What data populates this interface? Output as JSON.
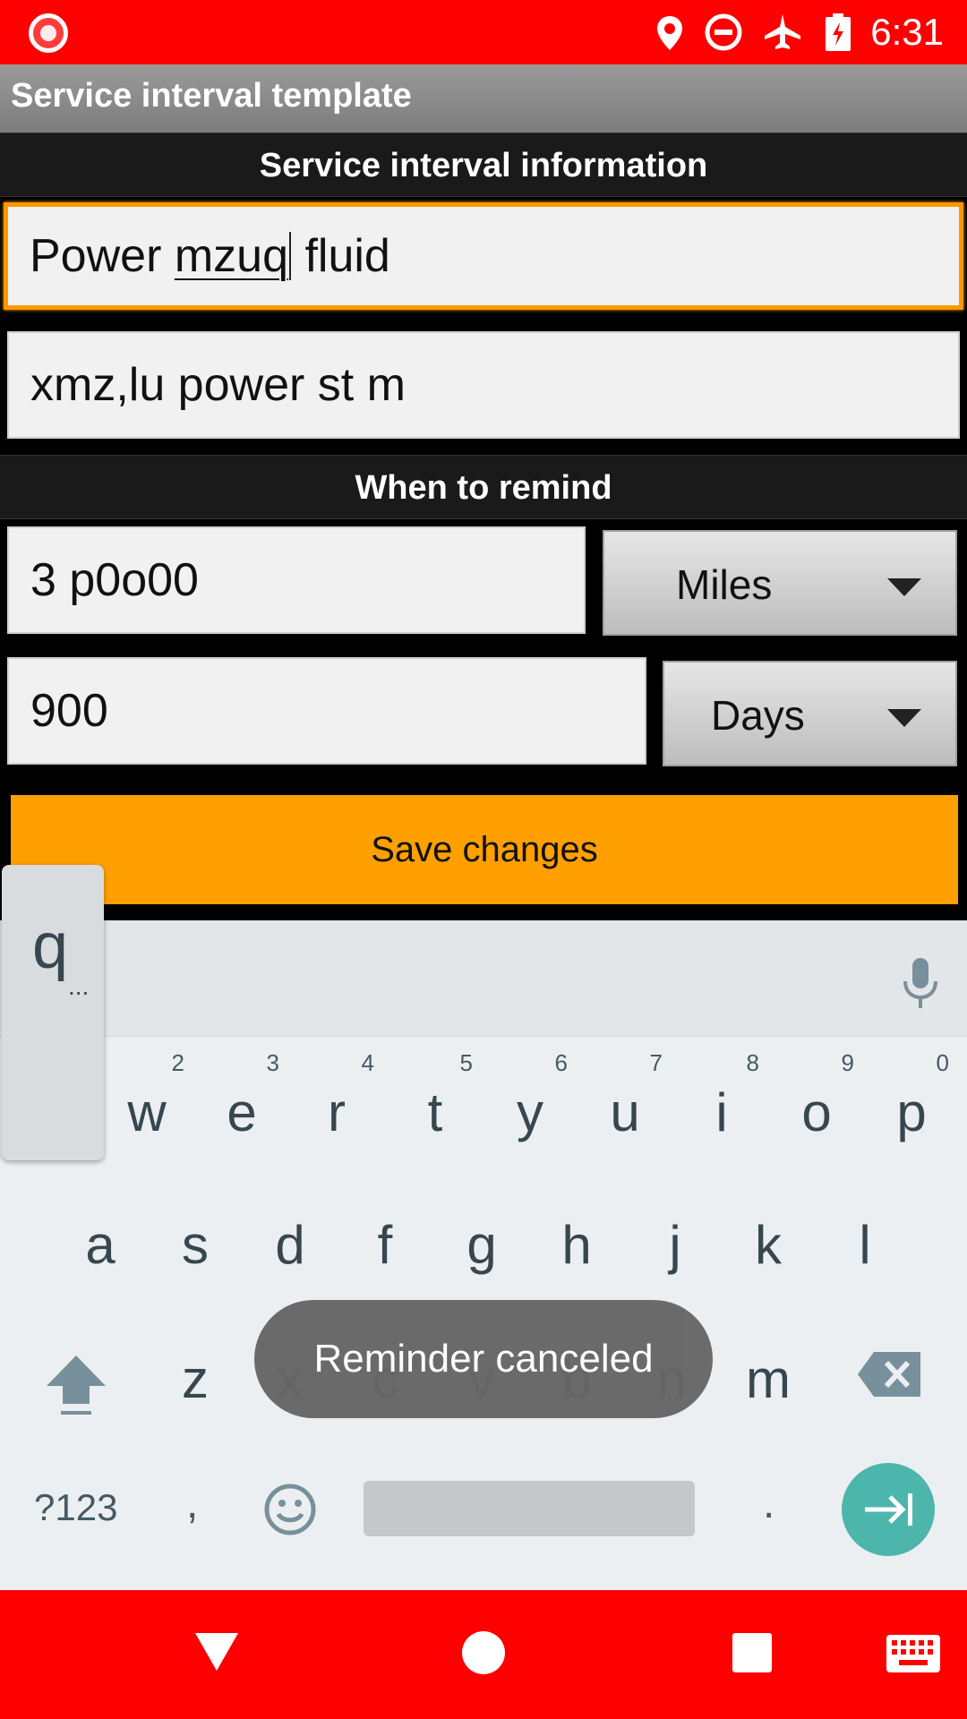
{
  "status_bar": {
    "time": "6:31",
    "icons": [
      "screen-record-icon",
      "location-icon",
      "do-not-disturb-icon",
      "airplane-mode-icon",
      "battery-charging-icon"
    ]
  },
  "app_bar": {
    "title": "Service interval template"
  },
  "sections": {
    "info_header": "Service interval information",
    "remind_header": "When to remind"
  },
  "form": {
    "name_before": "Power ",
    "name_composing": "mzuq",
    "name_after": " fluid",
    "description": "xmz,lu power st m",
    "miles_value": "3 p0o00",
    "miles_unit": "Miles",
    "days_value": "900",
    "days_unit": "Days",
    "save_label": "Save changes"
  },
  "keyboard": {
    "popup_letter": "q",
    "popup_more": "...",
    "row1": [
      {
        "label": "w",
        "hint": "2"
      },
      {
        "label": "e",
        "hint": "3"
      },
      {
        "label": "r",
        "hint": "4"
      },
      {
        "label": "t",
        "hint": "5"
      },
      {
        "label": "y",
        "hint": "6"
      },
      {
        "label": "u",
        "hint": "7"
      },
      {
        "label": "i",
        "hint": "8"
      },
      {
        "label": "o",
        "hint": "9"
      },
      {
        "label": "p",
        "hint": "0"
      }
    ],
    "row2": [
      "a",
      "s",
      "d",
      "f",
      "g",
      "h",
      "j",
      "k",
      "l"
    ],
    "row3": [
      "z",
      "x",
      "c",
      "v",
      "b",
      "n",
      "m"
    ],
    "symbols_label": "?123",
    "comma_label": ",",
    "period_label": ".",
    "accent_color": "#4db6ac"
  },
  "toast": {
    "message": "Reminder canceled"
  },
  "nav_bar": {
    "icons": [
      "back-icon",
      "home-icon",
      "recents-icon",
      "keyboard-switch-icon"
    ]
  },
  "colors": {
    "status_bar": "#ff0000",
    "save_button": "#ffa000",
    "focus_border": "#ff9800"
  }
}
